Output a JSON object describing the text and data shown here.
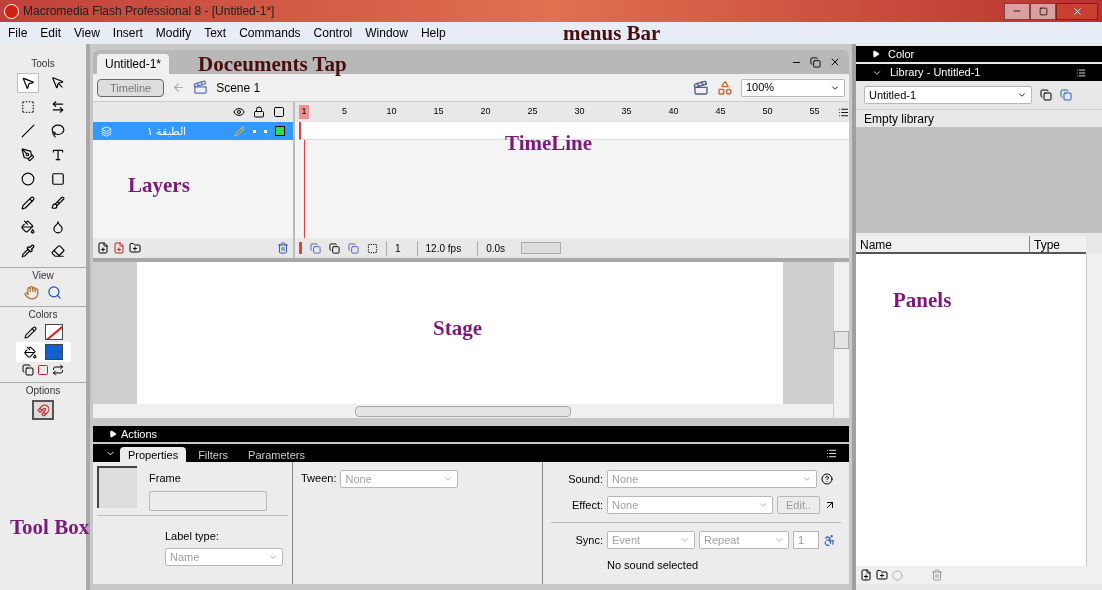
{
  "window": {
    "title": "Macromedia Flash Professional 8 - [Untitled-1*]"
  },
  "menu": [
    "File",
    "Edit",
    "View",
    "Insert",
    "Modify",
    "Text",
    "Commands",
    "Control",
    "Window",
    "Help"
  ],
  "tools": {
    "title": "Tools",
    "items": [
      {
        "selected": true
      },
      {
        "selected": false
      },
      {
        "selected": false
      },
      {
        "selected": false
      },
      {
        "selected": false
      },
      {
        "selected": false
      },
      {
        "selected": false
      },
      {
        "selected": false
      },
      {
        "selected": false
      },
      {
        "selected": false
      },
      {
        "selected": false
      },
      {
        "selected": false
      },
      {
        "selected": false
      },
      {
        "selected": false
      },
      {
        "selected": false
      },
      {
        "selected": false
      }
    ],
    "view_label": "View",
    "colors_label": "Colors",
    "options_label": "Options"
  },
  "document": {
    "tab": "Untitled-1*",
    "timeline_button": "Timeline",
    "scene": "Scene 1",
    "zoom": "100%"
  },
  "timeline": {
    "layers": [
      {
        "name": "الطبقة ١",
        "selected": true
      }
    ],
    "ruler": [
      "1",
      "5",
      "10",
      "15",
      "20",
      "25",
      "30",
      "35",
      "40",
      "45",
      "50",
      "55"
    ],
    "frame": "1",
    "fps": "12.0 fps",
    "time": "0.0s"
  },
  "actions_panel": {
    "title": "Actions",
    "expanded": false
  },
  "properties_panel": {
    "tabs": [
      {
        "label": "Properties",
        "selected": true
      },
      {
        "label": "Filters",
        "selected": false
      },
      {
        "label": "Parameters",
        "selected": false
      }
    ],
    "frame_label": "Frame",
    "label_type": "Label type:",
    "label_type_value": "Name",
    "tween_label": "Tween:",
    "tween_value": "None",
    "sound_label": "Sound:",
    "sound_value": "None",
    "effect_label": "Effect:",
    "effect_value": "None",
    "edit_button": "Edit..",
    "sync_label": "Sync:",
    "sync_value": "Event",
    "repeat_value": "Repeat",
    "repeat_count": "1",
    "status": "No sound selected"
  },
  "right_panels": {
    "color_title": "Color",
    "color_expanded": false,
    "library_title": "Library - Untitled-1",
    "library_expanded": true,
    "library_select": "Untitled-1",
    "empty_text": "Empty library",
    "columns": [
      "Name",
      "Type"
    ]
  },
  "annotations": [
    {
      "text": "menus Bar",
      "color": "#4a0c0c"
    },
    {
      "text": "Doceuments Tap",
      "color": "#4a0c0c"
    },
    {
      "text": "TimeLine",
      "color": "#7a1a7a"
    },
    {
      "text": "Layers",
      "color": "#7a1a7a"
    },
    {
      "text": "Stage",
      "color": "#7a1a7a"
    },
    {
      "text": "Panels",
      "color": "#7a1a7a"
    },
    {
      "text": "Tool Box",
      "color": "#7a1a7a"
    }
  ]
}
